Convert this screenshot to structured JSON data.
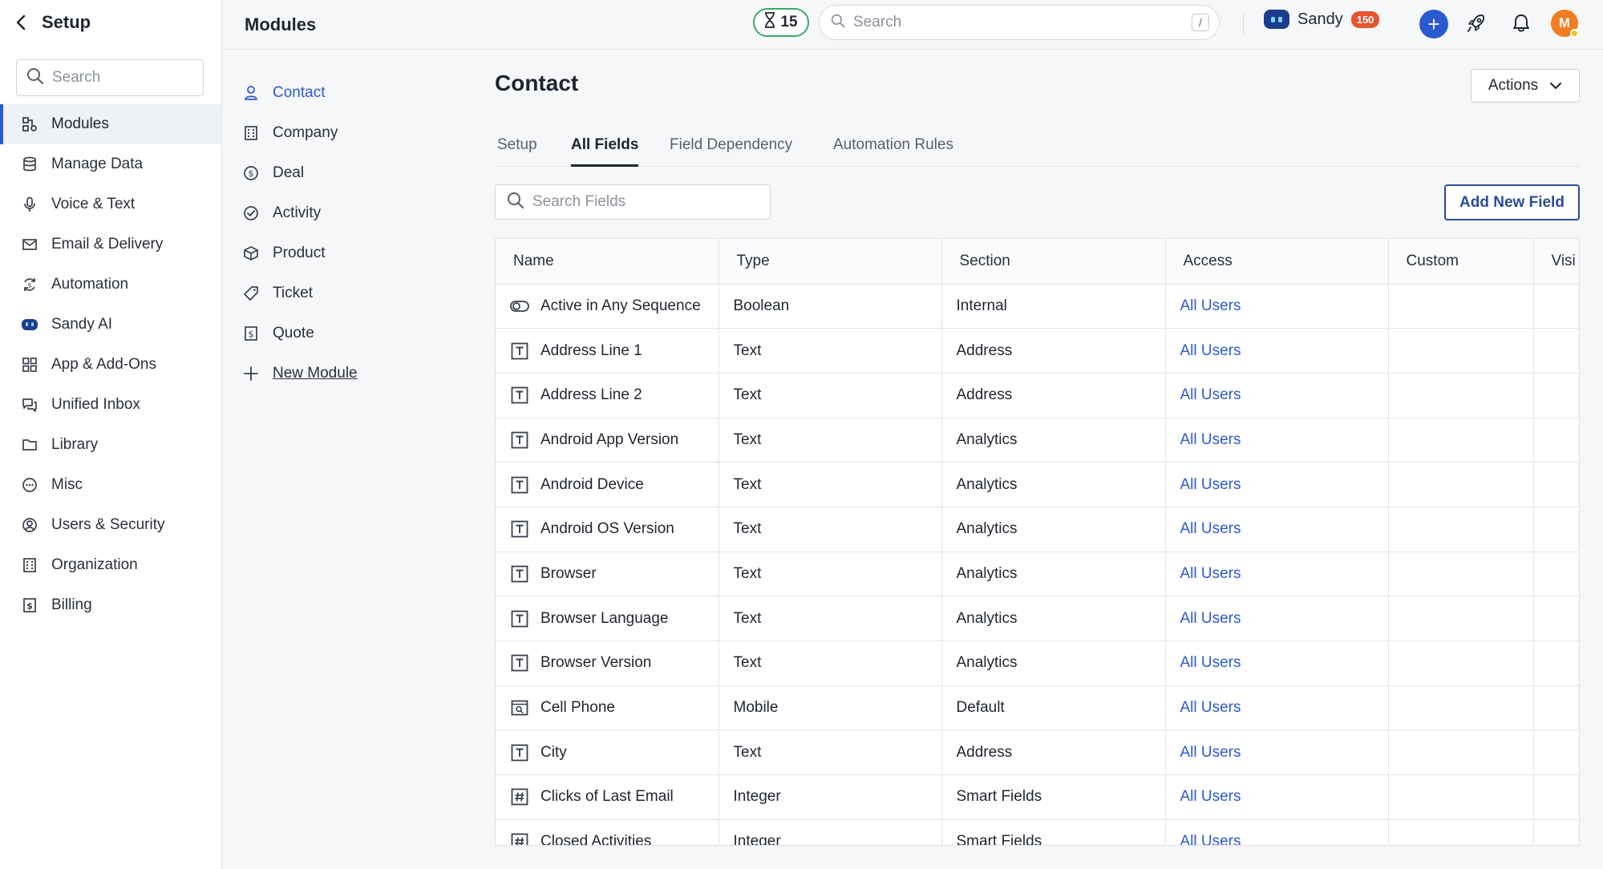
{
  "setup": {
    "title": "Setup",
    "search_placeholder": "Search",
    "items": [
      {
        "label": "Modules",
        "icon": "modules-icon"
      },
      {
        "label": "Manage Data",
        "icon": "database-icon"
      },
      {
        "label": "Voice & Text",
        "icon": "microphone-icon"
      },
      {
        "label": "Email & Delivery",
        "icon": "mail-icon"
      },
      {
        "label": "Automation",
        "icon": "automation-icon"
      },
      {
        "label": "Sandy AI",
        "icon": "sandy-bot-icon"
      },
      {
        "label": "App & Add-Ons",
        "icon": "grid-icon"
      },
      {
        "label": "Unified Inbox",
        "icon": "chat-icon"
      },
      {
        "label": "Library",
        "icon": "folder-icon"
      },
      {
        "label": "Misc",
        "icon": "ellipsis-circle-icon"
      },
      {
        "label": "Users & Security",
        "icon": "user-circle-icon"
      },
      {
        "label": "Organization",
        "icon": "building-icon"
      },
      {
        "label": "Billing",
        "icon": "billing-icon"
      }
    ]
  },
  "header": {
    "page_title": "Modules",
    "timer_count": "15",
    "search_placeholder": "Search",
    "search_shortcut": "/",
    "assistant_name": "Sandy",
    "assistant_badge": "150",
    "avatar_initial": "M",
    "accent_color": "#2b59d1"
  },
  "modules": {
    "items": [
      {
        "label": "Contact",
        "icon": "person-icon"
      },
      {
        "label": "Company",
        "icon": "building-icon"
      },
      {
        "label": "Deal",
        "icon": "dollar-circle-icon"
      },
      {
        "label": "Activity",
        "icon": "check-circle-icon"
      },
      {
        "label": "Product",
        "icon": "box-icon"
      },
      {
        "label": "Ticket",
        "icon": "tag-icon"
      },
      {
        "label": "Quote",
        "icon": "quote-doc-icon"
      },
      {
        "label": "New Module",
        "icon": "plus-icon"
      }
    ]
  },
  "main": {
    "title": "Contact",
    "actions_label": "Actions",
    "tabs": [
      "Setup",
      "All Fields",
      "Field Dependency",
      "Automation Rules"
    ],
    "field_search_placeholder": "Search Fields",
    "add_field_label": "Add New Field",
    "columns": [
      "Name",
      "Type",
      "Section",
      "Access",
      "Custom",
      "Visi"
    ],
    "rows": [
      {
        "name": "Active in Any Sequence",
        "type": "Boolean",
        "section": "Internal",
        "access": "All Users",
        "icon": "toggle-icon"
      },
      {
        "name": "Address Line 1",
        "type": "Text",
        "section": "Address",
        "access": "All Users",
        "icon": "text-field-icon"
      },
      {
        "name": "Address Line 2",
        "type": "Text",
        "section": "Address",
        "access": "All Users",
        "icon": "text-field-icon"
      },
      {
        "name": "Android App Version",
        "type": "Text",
        "section": "Analytics",
        "access": "All Users",
        "icon": "text-field-icon"
      },
      {
        "name": "Android Device",
        "type": "Text",
        "section": "Analytics",
        "access": "All Users",
        "icon": "text-field-icon"
      },
      {
        "name": "Android OS Version",
        "type": "Text",
        "section": "Analytics",
        "access": "All Users",
        "icon": "text-field-icon"
      },
      {
        "name": "Browser",
        "type": "Text",
        "section": "Analytics",
        "access": "All Users",
        "icon": "text-field-icon"
      },
      {
        "name": "Browser Language",
        "type": "Text",
        "section": "Analytics",
        "access": "All Users",
        "icon": "text-field-icon"
      },
      {
        "name": "Browser Version",
        "type": "Text",
        "section": "Analytics",
        "access": "All Users",
        "icon": "text-field-icon"
      },
      {
        "name": "Cell Phone",
        "type": "Mobile",
        "section": "Default",
        "access": "All Users",
        "icon": "phone-field-icon"
      },
      {
        "name": "City",
        "type": "Text",
        "section": "Address",
        "access": "All Users",
        "icon": "text-field-icon"
      },
      {
        "name": "Clicks of Last Email",
        "type": "Integer",
        "section": "Smart Fields",
        "access": "All Users",
        "icon": "number-field-icon"
      },
      {
        "name": "Closed Activities",
        "type": "Integer",
        "section": "Smart Fields",
        "access": "All Users",
        "icon": "number-field-icon"
      }
    ]
  }
}
